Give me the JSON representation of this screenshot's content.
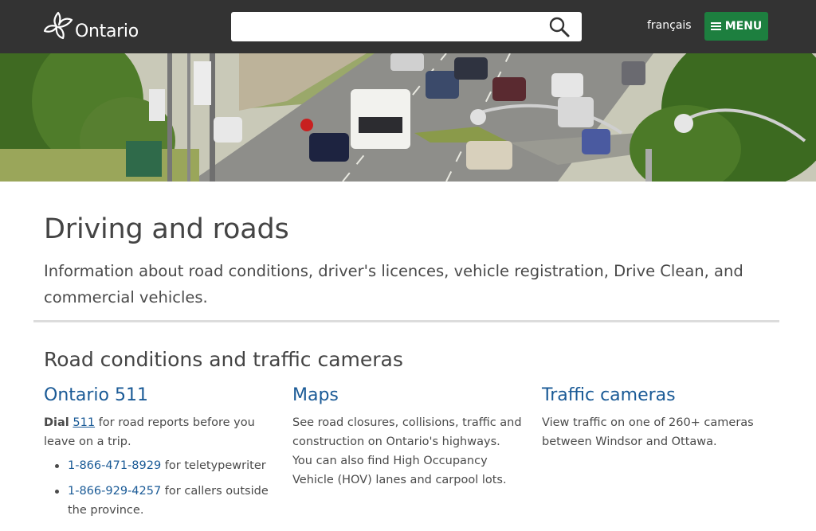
{
  "header": {
    "logo_text": "Ontario",
    "search_placeholder": "",
    "language_link": "français",
    "menu_label": "MENU"
  },
  "main": {
    "title": "Driving and roads",
    "intro": "Information about road conditions, driver's licences, vehicle registration, Drive Clean, and commercial vehicles.",
    "section_title": "Road conditions and traffic cameras",
    "columns": [
      {
        "heading": "Ontario 511",
        "text_prefix": "Dial",
        "text_link": "511",
        "text_suffix": " for road reports before you leave on a trip.",
        "list": [
          {
            "phone": "1-866-471-8929",
            "desc": " for teletypewriter"
          },
          {
            "phone": "1-866-929-4257",
            "desc": " for callers outside the province."
          }
        ]
      },
      {
        "heading": "Maps",
        "text": "See road closures, collisions, traffic and construction on Ontario's highways. You can also find High Occupancy Vehicle (HOV) lanes and carpool lots."
      },
      {
        "heading": "Traffic cameras",
        "text": "View traffic on one of 260+ cameras between Windsor and Ottawa."
      }
    ]
  },
  "colors": {
    "header_bg": "#333333",
    "menu_green": "#1d7f3f",
    "link_blue": "#1a5a96",
    "text": "#4a4a4a"
  },
  "icons": {
    "logo": "trillium-icon",
    "search": "search-icon",
    "menu": "hamburger-icon"
  }
}
